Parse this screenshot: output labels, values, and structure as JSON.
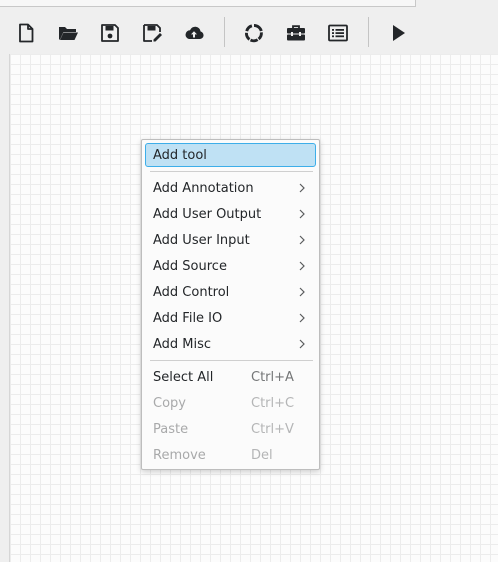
{
  "toolbar": {
    "buttons": [
      {
        "icon": "new-file-icon"
      },
      {
        "icon": "open-folder-icon"
      },
      {
        "icon": "save-icon"
      },
      {
        "icon": "save-as-icon"
      },
      {
        "icon": "cloud-upload-icon"
      },
      {
        "icon": "loading-spinner-icon"
      },
      {
        "icon": "toolbox-icon"
      },
      {
        "icon": "list-icon"
      },
      {
        "icon": "run-icon"
      }
    ]
  },
  "context_menu": {
    "items": [
      {
        "label": "Add tool",
        "highlighted": true
      },
      {
        "label": "Add Annotation",
        "submenu": true
      },
      {
        "label": "Add User Output",
        "submenu": true
      },
      {
        "label": "Add User Input",
        "submenu": true
      },
      {
        "label": "Add Source",
        "submenu": true
      },
      {
        "label": "Add Control",
        "submenu": true
      },
      {
        "label": "Add File IO",
        "submenu": true
      },
      {
        "label": "Add Misc",
        "submenu": true
      },
      {
        "label": "Select All",
        "shortcut": "Ctrl+A",
        "enabled": true
      },
      {
        "label": "Copy",
        "shortcut": "Ctrl+C",
        "enabled": false
      },
      {
        "label": "Paste",
        "shortcut": "Ctrl+V",
        "enabled": false
      },
      {
        "label": "Remove",
        "shortcut": "Del",
        "enabled": false
      }
    ]
  },
  "colors": {
    "highlight_fill": "#bfe1f4",
    "highlight_border": "#3daee9",
    "icon": "#232629",
    "disabled_text": "#a8a9aa"
  }
}
